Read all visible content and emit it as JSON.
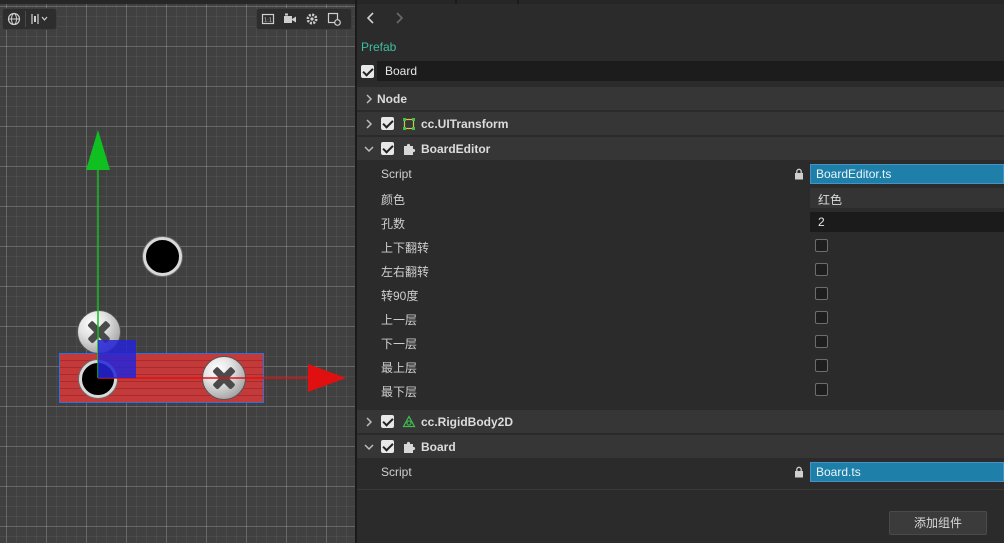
{
  "scene_toolbar": {
    "left_icons": [
      "globe-icon",
      "align-icon"
    ],
    "right_icons": [
      "frame-icon",
      "camera-icon",
      "gear-icon",
      "snap-icon"
    ]
  },
  "inspector": {
    "prefab_label": "Prefab",
    "node_name": "Board",
    "node_active": true,
    "sections": {
      "node": {
        "title": "Node"
      },
      "uitransform": {
        "title": "cc.UITransform",
        "enabled": true
      },
      "boardeditor": {
        "title": "BoardEditor",
        "enabled": true,
        "props": {
          "script_label": "Script",
          "script_value": "BoardEditor.ts",
          "color_label": "颜色",
          "color_value": "红色",
          "holes_label": "孔数",
          "holes_value": "2",
          "flip_v_label": "上下翻转",
          "flip_h_label": "左右翻转",
          "rotate_label": "转90度",
          "up_layer_label": "上一层",
          "down_layer_label": "下一层",
          "top_layer_label": "最上层",
          "bottom_layer_label": "最下层"
        }
      },
      "rigidbody": {
        "title": "cc.RigidBody2D",
        "enabled": true
      },
      "board": {
        "title": "Board",
        "enabled": true,
        "props": {
          "script_label": "Script",
          "script_value": "Board.ts"
        }
      }
    },
    "add_component_label": "添加组件"
  },
  "colors": {
    "board_red": "#c43a3a",
    "gizmo_x": "#e01010",
    "gizmo_y": "#10c020",
    "asset_field": "#1e7fa8",
    "prefab_label": "#3fbfa0"
  }
}
